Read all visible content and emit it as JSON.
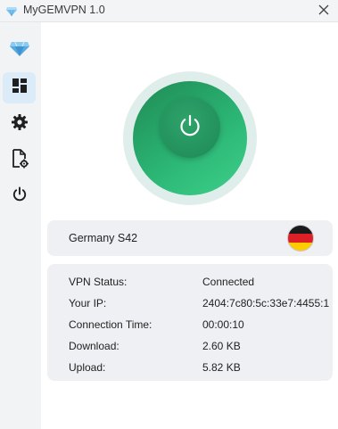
{
  "window": {
    "title": "MyGEMVPN 1.0",
    "icons": {
      "app": "gem-icon",
      "close": "close-icon"
    }
  },
  "sidebar": {
    "items": [
      {
        "name": "logo",
        "icon": "gem-icon",
        "active": false
      },
      {
        "name": "dashboard",
        "icon": "dashboard-icon",
        "active": true
      },
      {
        "name": "settings",
        "icon": "gear-icon",
        "active": false
      },
      {
        "name": "file-settings",
        "icon": "file-gear-icon",
        "active": false
      },
      {
        "name": "power",
        "icon": "power-icon",
        "active": false
      }
    ]
  },
  "main": {
    "connect_button": {
      "icon": "power-icon",
      "state": "connected"
    },
    "server": {
      "name": "Germany S42",
      "flag": "germany-flag-icon"
    },
    "status": {
      "rows": [
        {
          "label": "VPN Status:",
          "value": "Connected"
        },
        {
          "label": "Your IP:",
          "value": "2404:7c80:5c:33e7:4455:1"
        },
        {
          "label": "Connection Time:",
          "value": "00:00:10"
        },
        {
          "label": "Download:",
          "value": "2.60 KB"
        },
        {
          "label": "Upload:",
          "value": "5.82 KB"
        }
      ]
    }
  },
  "colors": {
    "accent_green": "#2bb574",
    "active_nav": "#dcebf8",
    "card_bg": "#eef0f3",
    "sidebar_bg": "#f2f3f5"
  }
}
